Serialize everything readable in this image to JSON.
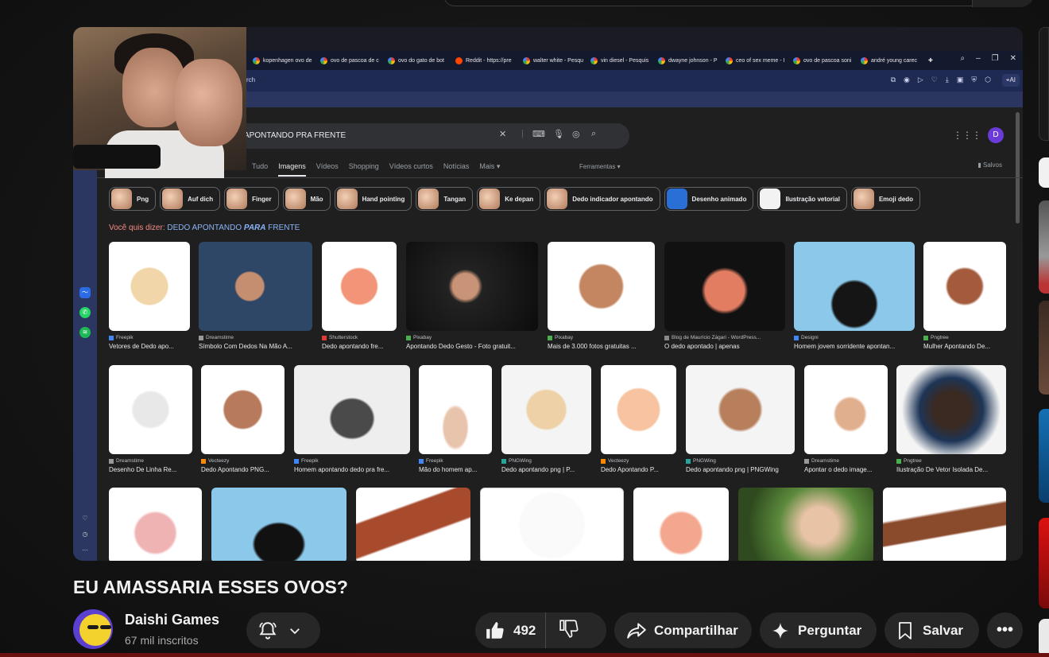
{
  "browser": {
    "tabs": [
      "kopenhagen ovo de",
      "ovo de pascoa de c",
      "ovo do gato de bot",
      "Reddit - https://pre",
      "walter white - Pesqu",
      "vin diesel - Pesquis",
      "dwayne johnson - P",
      "ceo of sex meme - I",
      "ovo de pascoa soni",
      "andré young carec"
    ],
    "address_text": "rch",
    "ai_label": "AI"
  },
  "google": {
    "query": "APONTANDO PRA FRENTE",
    "avatar_letter": "D",
    "tabs": [
      "Tudo",
      "Imagens",
      "Vídeos",
      "Shopping",
      "Vídeos curtos",
      "Notícias",
      "Mais"
    ],
    "tools": "Ferramentas",
    "saved": "Salvos",
    "chips": [
      "Png",
      "Auf dich",
      "Finger",
      "Mão",
      "Hand pointing",
      "Tangan",
      "Ke depan",
      "Dedo indicador apontando",
      "Desenho animado",
      "Ilustração vetorial",
      "Emoji dedo"
    ],
    "did_you_mean_prefix": "Você quis dizer:",
    "did_you_mean_a": "DEDO APONTANDO",
    "did_you_mean_b": "PARA",
    "did_you_mean_c": "FRENTE",
    "row1": [
      {
        "src": "Freepik",
        "title": "Vetores de Dedo apo..."
      },
      {
        "src": "Dreamstime",
        "title": "Símbolo Com Dedos Na Mão A..."
      },
      {
        "src": "Shutterstock",
        "title": "Dedo apontando fre..."
      },
      {
        "src": "Pixabay",
        "title": "Apontando Dedo Gesto - Foto gratuit..."
      },
      {
        "src": "Pixabay",
        "title": "Mais de 3.000 fotos gratuitas ..."
      },
      {
        "src": "Blog de Maurício Zágari - WordPress...",
        "title": "O dedo apontado | apenas"
      },
      {
        "src": "Designi",
        "title": "Homem jovem sorridente apontan..."
      },
      {
        "src": "Pngtree",
        "title": "Mulher Apontando De..."
      }
    ],
    "row2": [
      {
        "src": "Dreamstime",
        "title": "Desenho De Linha Re..."
      },
      {
        "src": "Vecteezy",
        "title": "Dedo Apontando PNG..."
      },
      {
        "src": "Freepik",
        "title": "Homem apontando dedo pra fre..."
      },
      {
        "src": "Freepik",
        "title": "Mão do homem ap..."
      },
      {
        "src": "PNGWing",
        "title": "Dedo apontando png | P..."
      },
      {
        "src": "Vecteezy",
        "title": "Dedo Apontando P..."
      },
      {
        "src": "PNGWing",
        "title": "Dedo apontando png | PNGWing"
      },
      {
        "src": "Dreamstime",
        "title": "Apontar o dedo image..."
      },
      {
        "src": "Pngtree",
        "title": "Ilustração De Vetor Isolada De..."
      }
    ]
  },
  "video": {
    "title": "EU AMASSARIA ESSES OVOS?",
    "channel": "Daishi Games",
    "subscribers": "67 mil inscritos",
    "likes": "492",
    "share": "Compartilhar",
    "ask": "Perguntar",
    "save": "Salvar",
    "more": "•••"
  },
  "colors": {
    "accent_red": "#ff0000",
    "pill_bg": "#272727"
  }
}
